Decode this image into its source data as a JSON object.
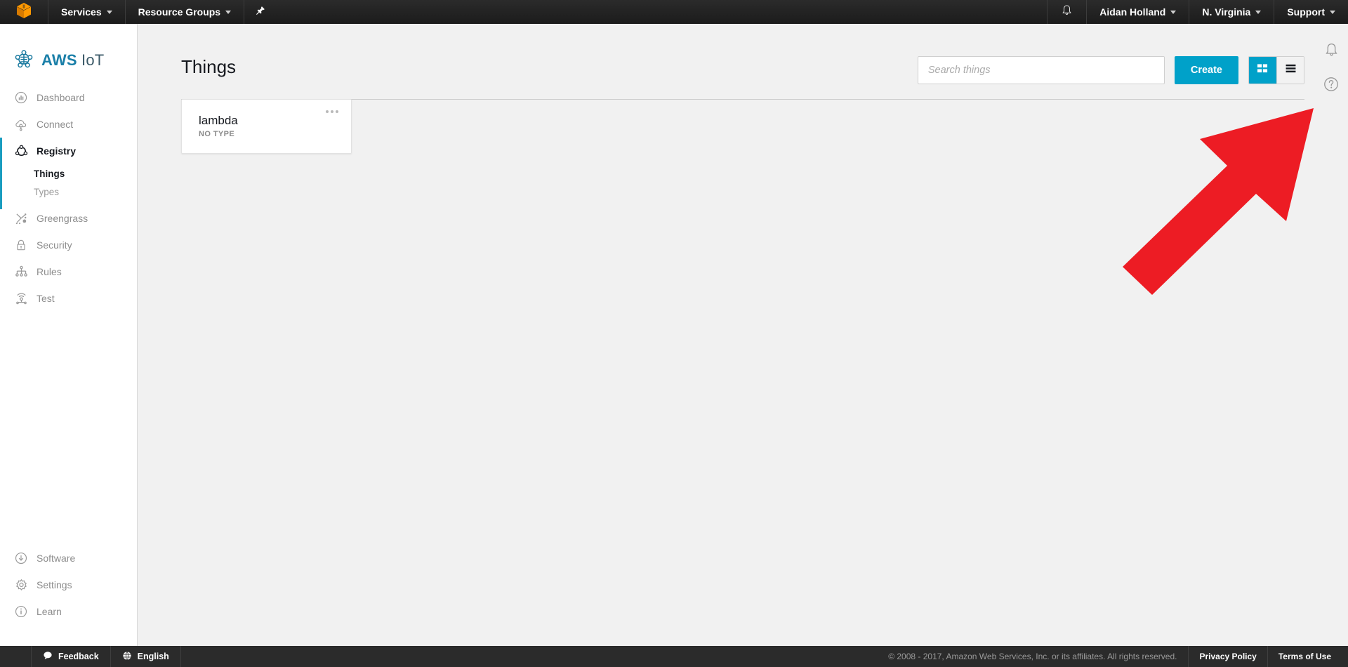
{
  "topnav": {
    "logo_icon": "aws-cube-logo",
    "services_label": "Services",
    "resource_groups_label": "Resource Groups",
    "pin_icon": "pushpin-icon",
    "bell_icon": "bell-icon",
    "user_label": "Aidan Holland",
    "region_label": "N. Virginia",
    "support_label": "Support"
  },
  "sidebar": {
    "brand_bold": "AWS",
    "brand_light": " IoT",
    "brand_icon": "aws-iot-node-logo",
    "items": [
      {
        "label": "Dashboard",
        "icon": "dashboard-chart-icon",
        "active": false
      },
      {
        "label": "Connect",
        "icon": "cloud-connect-icon",
        "active": false
      },
      {
        "label": "Registry",
        "icon": "registry-node-icon",
        "active": true
      },
      {
        "label": "Greengrass",
        "icon": "greengrass-icon",
        "active": false
      },
      {
        "label": "Security",
        "icon": "lock-icon",
        "active": false
      },
      {
        "label": "Rules",
        "icon": "rules-tree-icon",
        "active": false
      },
      {
        "label": "Test",
        "icon": "test-signal-icon",
        "active": false
      }
    ],
    "sub_items": [
      {
        "label": "Things",
        "active": true
      },
      {
        "label": "Types",
        "active": false
      }
    ],
    "bottom_items": [
      {
        "label": "Software",
        "icon": "download-circle-icon"
      },
      {
        "label": "Settings",
        "icon": "gear-icon"
      },
      {
        "label": "Learn",
        "icon": "info-circle-icon"
      }
    ]
  },
  "main": {
    "page_title": "Things",
    "search_placeholder": "Search things",
    "search_value": "",
    "create_label": "Create",
    "view_toggles": [
      {
        "name": "card-view",
        "icon": "grid-view-icon",
        "active": true
      },
      {
        "name": "list-view",
        "icon": "list-view-icon",
        "active": false
      }
    ],
    "things": [
      {
        "name": "lambda",
        "type": "NO TYPE"
      }
    ]
  },
  "rail": {
    "notifications_icon": "bell-icon",
    "help_icon": "help-circle-icon"
  },
  "annotation": {
    "shape": "red-arrow-pointing-up-right",
    "color": "#ED1C24"
  },
  "footer": {
    "feedback_label": "Feedback",
    "feedback_icon": "speech-bubble-icon",
    "language_label": "English",
    "language_icon": "globe-icon",
    "copyright": "© 2008 - 2017, Amazon Web Services, Inc. or its affiliates. All rights reserved.",
    "privacy_label": "Privacy Policy",
    "terms_label": "Terms of Use"
  },
  "colors": {
    "accent_teal": "#00A1C9",
    "brand_orange": "#F90",
    "nav_dark": "#232323",
    "annotation_red": "#ED1C24"
  }
}
